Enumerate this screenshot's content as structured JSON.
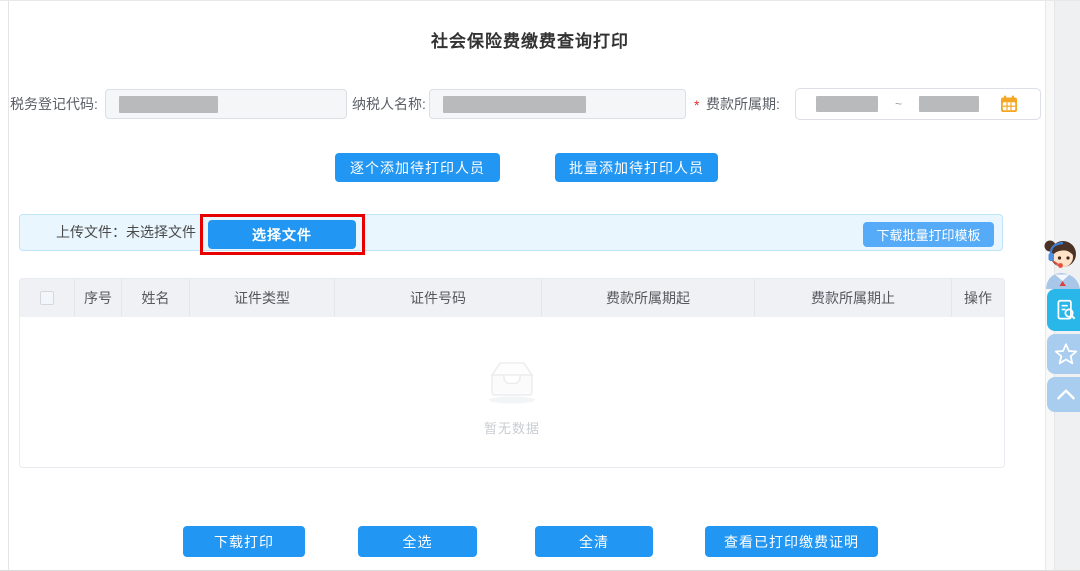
{
  "page": {
    "title": "社会保险费缴费查询打印"
  },
  "form": {
    "tax_code_label": "税务登记代码:",
    "taxpayer_name_label": "纳税人名称:",
    "fee_period_required_mark": "*",
    "fee_period_label": "费款所属期:",
    "fee_period_separator": "~",
    "calendar_icon": "calendar-icon"
  },
  "top_actions": {
    "add_single_label": "逐个添加待打印人员",
    "add_batch_label": "批量添加待打印人员"
  },
  "upload_bar": {
    "upload_label": "上传文件：未选择文件",
    "choose_file_label": "选择文件",
    "download_template_label": "下载批量打印模板"
  },
  "table": {
    "headers": [
      "序号",
      "姓名",
      "证件类型",
      "证件号码",
      "费款所属期起",
      "费款所属期止",
      "操作"
    ],
    "rows": [],
    "empty_text": "暂无数据"
  },
  "bottom_actions": {
    "download_print_label": "下载打印",
    "select_all_label": "全选",
    "clear_all_label": "全清",
    "view_printed_label": "查看已打印缴费证明"
  },
  "sidebar": {
    "icons": [
      "customer-service-avatar",
      "document-search-icon",
      "star-icon",
      "collapse-up-icon"
    ]
  },
  "annotation": {
    "type": "highlight-box",
    "target": "choose-file-button",
    "color": "#e60000"
  },
  "colors": {
    "primary_blue": "#2196f3",
    "template_button_blue": "#55abf7",
    "upload_bar_bg": "#e9f6fe",
    "upload_bar_border": "#c0e4f8",
    "table_header_bg": "#eff1f4",
    "sidebar_button_cyan": "#29b7ea",
    "sidebar_button_light": "#a9cdee",
    "calendar_orange": "#f5a623",
    "redacted_bar_gray": "#b9babc",
    "annotation_red": "#e60000"
  }
}
